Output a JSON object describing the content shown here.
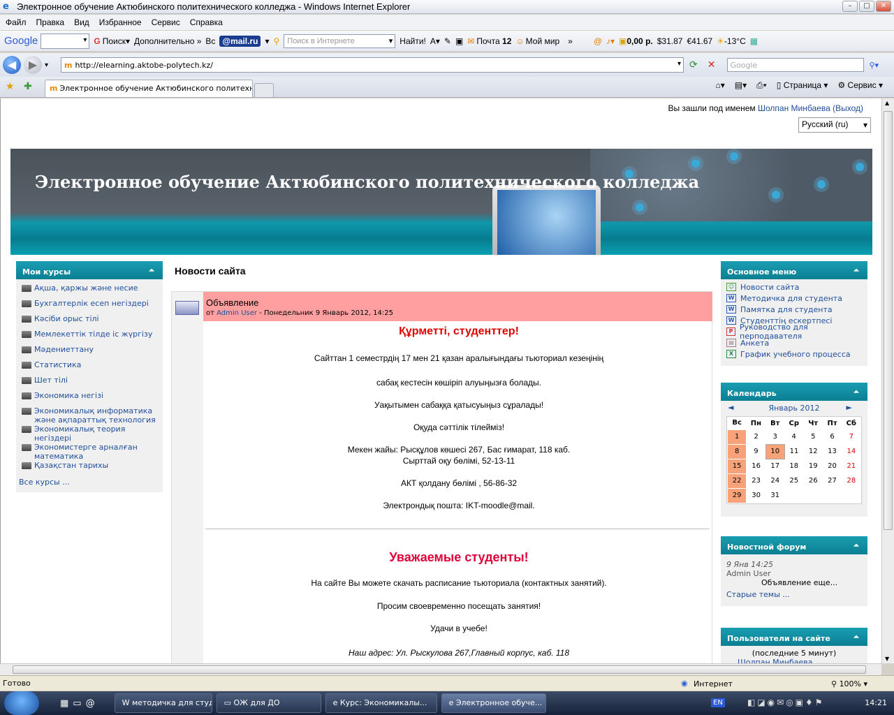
{
  "window": {
    "title": "Электронное обучение Актюбинского политехнического колледжа - Windows Internet Explorer"
  },
  "menu": [
    "Файл",
    "Правка",
    "Вид",
    "Избранное",
    "Сервис",
    "Справка"
  ],
  "toolbar": {
    "google": "Google",
    "search": "Поиск",
    "more": "Дополнительно »",
    "vc": "Вс",
    "mailru": "@mail.ru",
    "internet_search_placeholder": "Поиск в Интернете",
    "find": "Найти!",
    "mail": "Почта",
    "mail_count": "12",
    "myworld": "Мой мир",
    "money": "0,00 р.",
    "usd": "31.87",
    "eur": "41.67",
    "temp": "-13°C"
  },
  "address": {
    "url": "http://elearning.aktobe-polytech.kz/",
    "search_placeholder": "Google"
  },
  "tab": {
    "label": "Электронное обучение Актюбинского политехнич...",
    "page": "Страница",
    "service": "Сервис"
  },
  "moodle": {
    "login_prefix": "Вы зашли под именем",
    "user": "Шолпан Минбаева",
    "logout": "(Выход)",
    "lang": "Русский (ru)",
    "site_title": "Электронное обучение Актюбинского политехнического колледжа",
    "news_title": "Новости сайта"
  },
  "my_courses": {
    "title": "Мои курсы",
    "items": [
      "Ақша, қаржы және несие",
      "Бухгалтерлік есеп негіздері",
      "Кәсіби орыс тілі",
      "Мемлекеттік тілде іс жүргізу",
      "Мәдениеттану",
      "Статистика",
      "Шет тілі",
      "Экономика негізі",
      "Экономикалық информатика және ақпараттық технология",
      "Экономикалық теория негіздері",
      "Экономистерге арналған математика",
      "Қазақстан тарихы"
    ],
    "all": "Все курсы ..."
  },
  "post": {
    "subject": "Объявление",
    "by_prefix": "от",
    "author": "Admin User",
    "date": "- Понедельник 9 Январь 2012, 14:25",
    "lines": [
      "Құрметті, студенттер!",
      "Сайттан 1 семестрдің 17 мен 21 қазан аралығындағы тьюториал кезеңінің",
      "сабақ кестесін көшіріп алуыңызға болады.",
      "Уақытымен сабаққа қатысуыңыз сұралады!",
      "Оқуда сәттілік тілейміз!",
      "Мекен жайы: Рысқұлов көшесі 267, Бас ғимарат, 118 каб.",
      "Сырттай оқу бөлімі, 52-13-11",
      "АКТ қолдану бөлімі , 56-86-32",
      "Электрондық пошта: IKT-moodle@mail.",
      "Уважаемые студенты!",
      "На сайте Вы можете скачать расписание тьюториала (контактных занятий).",
      "Просим своевременно посещать занятия!",
      "Удачи в учебе!",
      "Наш адрес: Ул. Рыскулова 267,Главный корпус, каб. 118"
    ]
  },
  "main_menu": {
    "title": "Основное меню",
    "items": [
      "Новости сайта",
      "Методичка для студента",
      "Памятка для студента",
      "Студенттің ескертпесі",
      "Руководство для перподавателя",
      "Анкета",
      "График учебного процесса"
    ]
  },
  "calendar": {
    "title": "Календарь",
    "month": "Январь 2012",
    "days": [
      "Вс",
      "Пн",
      "Вт",
      "Ср",
      "Чт",
      "Пт",
      "Сб"
    ],
    "weeks": [
      [
        "1",
        "2",
        "3",
        "4",
        "5",
        "6",
        "7"
      ],
      [
        "8",
        "9",
        "10",
        "11",
        "12",
        "13",
        "14"
      ],
      [
        "15",
        "16",
        "17",
        "18",
        "19",
        "20",
        "21"
      ],
      [
        "22",
        "23",
        "24",
        "25",
        "26",
        "27",
        "28"
      ],
      [
        "29",
        "30",
        "31",
        "",
        "",
        "",
        ""
      ]
    ]
  },
  "forum": {
    "title": "Новостной форум",
    "date": "9 Янв 14:25",
    "author": "Admin User",
    "item": "Объявление еще...",
    "old": "Старые темы ..."
  },
  "online": {
    "title": "Пользователи на сайте",
    "note": "(последние 5 минут)",
    "user": "Шолпан Минбаева"
  },
  "status": {
    "done": "Готово",
    "zone": "Интернет",
    "zoom": "100%"
  },
  "taskbar": {
    "items": [
      "методичка для студ...",
      "ОЖ  для ДО",
      "Курс: Экономикалы...",
      "Электронное обуче..."
    ],
    "lang": "EN",
    "time": "14:21"
  }
}
